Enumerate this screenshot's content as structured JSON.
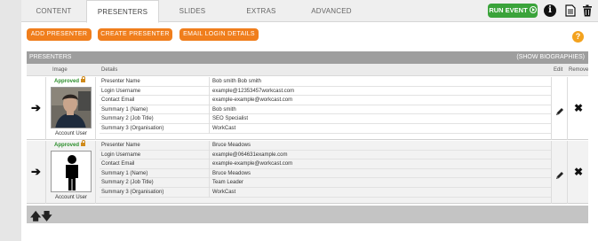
{
  "tabs": [
    {
      "label": "CONTENT",
      "active": false
    },
    {
      "label": "PRESENTERS",
      "active": true
    },
    {
      "label": "SLIDES",
      "active": false
    },
    {
      "label": "EXTRAS",
      "active": false
    },
    {
      "label": "ADVANCED",
      "active": false
    }
  ],
  "toolbar": {
    "run_event_label": "RUN EVENT",
    "info_icon": "info-icon",
    "doc_icon": "document-icon",
    "trash_icon": "trash-icon"
  },
  "actions": {
    "add_presenter": "ADD PRESENTER",
    "create_presenter": "CREATE PRESENTER",
    "email_login": "EMAIL LOGIN DETAILS",
    "help_glyph": "?"
  },
  "panel": {
    "title": "PRESENTERS",
    "show_bio": "(SHOW BIOGRAPHIES)",
    "columns": {
      "image": "Image",
      "details": "Details",
      "edit": "Edit",
      "remove": "Remove"
    }
  },
  "presenters": [
    {
      "status": "Approved",
      "account_type": "Account User",
      "details": [
        {
          "label": "Presenter Name",
          "value": "Bob smith  Bob smith"
        },
        {
          "label": "Login Username",
          "value": "example@12353457workcast.com"
        },
        {
          "label": "Contact Email",
          "value": "example-example@workcast.com"
        },
        {
          "label": "Summary 1 (Name)",
          "value": "Bob smith"
        },
        {
          "label": "Summary 2 (Job Title)",
          "value": "SEO Specialist"
        },
        {
          "label": "Summary 3 (Organisation)",
          "value": "WorkCast"
        }
      ]
    },
    {
      "status": "Approved",
      "account_type": "Account User",
      "details": [
        {
          "label": "Presenter Name",
          "value": "Bruce  Meadows"
        },
        {
          "label": "Login Username",
          "value": "example@064631example.com"
        },
        {
          "label": "Contact Email",
          "value": "example-example@workcast.com"
        },
        {
          "label": "Summary 1 (Name)",
          "value": "Bruce Meadows"
        },
        {
          "label": "Summary 2 (Job Title)",
          "value": "Team Leader"
        },
        {
          "label": "Summary 3 (Organisation)",
          "value": "WorkCast"
        }
      ]
    }
  ],
  "colors": {
    "accent_orange": "#f07e1c",
    "run_green": "#3aa33a",
    "header_grey": "#9e9e9e"
  }
}
